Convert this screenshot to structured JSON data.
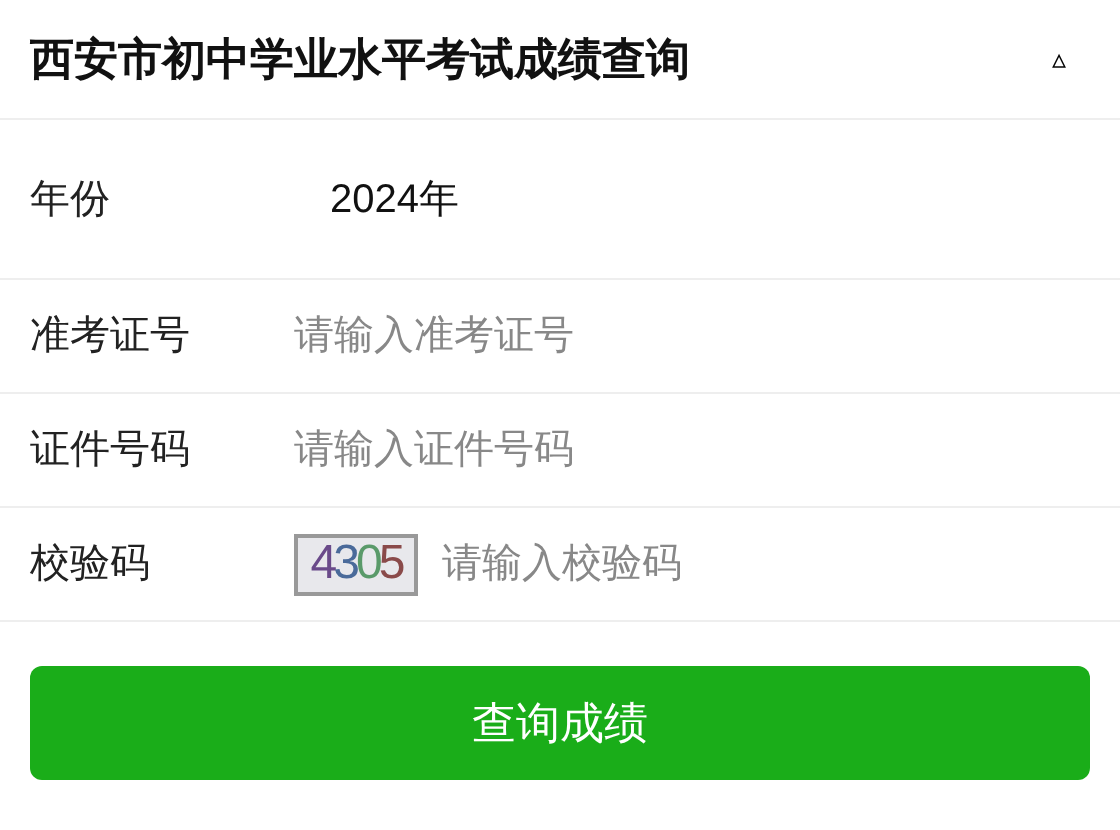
{
  "header": {
    "title": "西安市初中学业水平考试成绩查询",
    "toggle": "▵"
  },
  "fields": [
    {
      "kind": "static",
      "label": "年份",
      "value": "2024年"
    },
    {
      "kind": "input",
      "label": "准考证号",
      "placeholder": "请输入准考证号"
    },
    {
      "kind": "input",
      "label": "证件号码",
      "placeholder": "请输入证件号码"
    },
    {
      "kind": "captcha",
      "label": "校验码",
      "captcha": "4305",
      "placeholder": "请输入校验码"
    }
  ],
  "submit": "查询成绩"
}
